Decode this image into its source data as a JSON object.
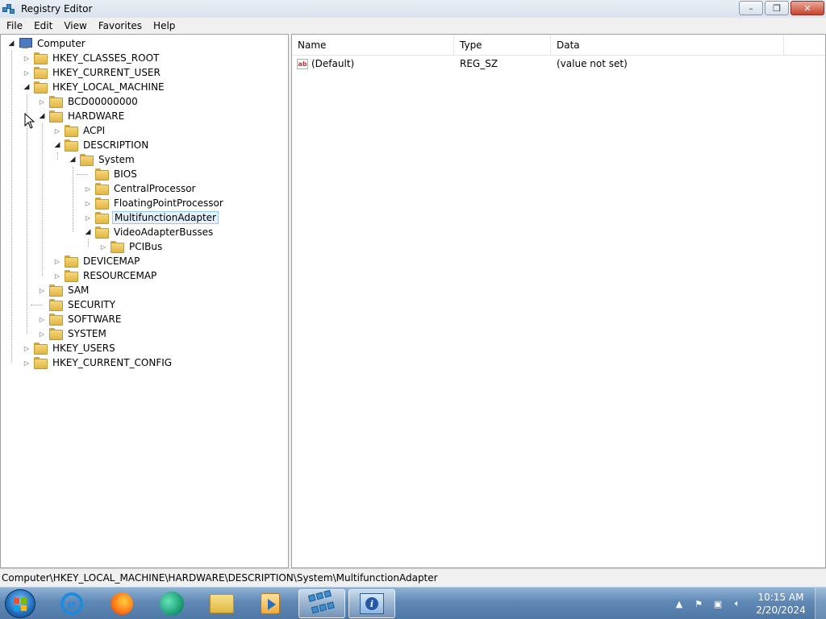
{
  "window": {
    "title": "Registry Editor",
    "buttons": {
      "minimize": "–",
      "maximize": "❐",
      "close": "✕"
    }
  },
  "menu": [
    "File",
    "Edit",
    "View",
    "Favorites",
    "Help"
  ],
  "tree": [
    {
      "label": "Computer",
      "depth": 0,
      "state": "open",
      "icon": "computer-icon"
    },
    {
      "label": "HKEY_CLASSES_ROOT",
      "depth": 1,
      "state": "closed",
      "icon": "folder-icon"
    },
    {
      "label": "HKEY_CURRENT_USER",
      "depth": 1,
      "state": "closed",
      "icon": "folder-icon"
    },
    {
      "label": "HKEY_LOCAL_MACHINE",
      "depth": 1,
      "state": "open",
      "icon": "folder-icon"
    },
    {
      "label": "BCD00000000",
      "depth": 2,
      "state": "closed",
      "icon": "folder-icon"
    },
    {
      "label": "HARDWARE",
      "depth": 2,
      "state": "open",
      "icon": "folder-icon"
    },
    {
      "label": "ACPI",
      "depth": 3,
      "state": "closed",
      "icon": "folder-icon"
    },
    {
      "label": "DESCRIPTION",
      "depth": 3,
      "state": "open",
      "icon": "folder-icon"
    },
    {
      "label": "System",
      "depth": 4,
      "state": "open",
      "icon": "folder-icon"
    },
    {
      "label": "BIOS",
      "depth": 5,
      "state": "none",
      "icon": "folder-icon"
    },
    {
      "label": "CentralProcessor",
      "depth": 5,
      "state": "closed",
      "icon": "folder-icon"
    },
    {
      "label": "FloatingPointProcessor",
      "depth": 5,
      "state": "closed",
      "icon": "folder-icon"
    },
    {
      "label": "MultifunctionAdapter",
      "depth": 5,
      "state": "closed",
      "icon": "folder-icon",
      "selected": true
    },
    {
      "label": "VideoAdapterBusses",
      "depth": 5,
      "state": "open",
      "icon": "folder-icon"
    },
    {
      "label": "PCIBus",
      "depth": 6,
      "state": "closed",
      "icon": "folder-icon"
    },
    {
      "label": "DEVICEMAP",
      "depth": 3,
      "state": "closed",
      "icon": "folder-icon"
    },
    {
      "label": "RESOURCEMAP",
      "depth": 3,
      "state": "closed",
      "icon": "folder-icon"
    },
    {
      "label": "SAM",
      "depth": 2,
      "state": "closed",
      "icon": "folder-icon"
    },
    {
      "label": "SECURITY",
      "depth": 2,
      "state": "none",
      "icon": "folder-icon"
    },
    {
      "label": "SOFTWARE",
      "depth": 2,
      "state": "closed",
      "icon": "folder-icon"
    },
    {
      "label": "SYSTEM",
      "depth": 2,
      "state": "closed",
      "icon": "folder-icon"
    },
    {
      "label": "HKEY_USERS",
      "depth": 1,
      "state": "closed",
      "icon": "folder-icon"
    },
    {
      "label": "HKEY_CURRENT_CONFIG",
      "depth": 1,
      "state": "closed",
      "icon": "folder-icon"
    }
  ],
  "list": {
    "columns": [
      "Name",
      "Type",
      "Data"
    ],
    "rows": [
      {
        "name": "(Default)",
        "type": "REG_SZ",
        "data": "(value not set)",
        "icon": "string-value-icon"
      }
    ]
  },
  "status": {
    "path": "Computer\\HKEY_LOCAL_MACHINE\\HARDWARE\\DESCRIPTION\\System\\MultifunctionAdapter"
  },
  "taskbar": {
    "apps": [
      "internet-explorer-icon",
      "firefox-icon",
      "edge-icon",
      "file-explorer-icon",
      "media-player-icon",
      "registry-editor-icon",
      "system-information-icon"
    ],
    "clock": {
      "time": "10:15 AM",
      "date": "2/20/2024"
    }
  }
}
